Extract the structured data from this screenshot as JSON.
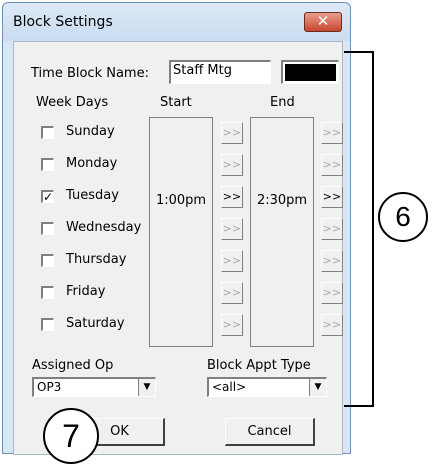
{
  "window": {
    "title": "Block Settings",
    "close_glyph": "✕"
  },
  "form": {
    "time_block_label": "Time Block Name:",
    "time_block_value": "Staff Mtg",
    "color_swatch": "#000000",
    "week_days_label": "Week Days",
    "start_label": "Start",
    "end_label": "End",
    "days": [
      {
        "label": "Sunday",
        "checked": false
      },
      {
        "label": "Monday",
        "checked": false
      },
      {
        "label": "Tuesday",
        "checked": true
      },
      {
        "label": "Wednesday",
        "checked": false
      },
      {
        "label": "Thursday",
        "checked": false
      },
      {
        "label": "Friday",
        "checked": false
      },
      {
        "label": "Saturday",
        "checked": false
      }
    ],
    "start_time": "1:00pm",
    "end_time": "2:30pm",
    "arrow_label": ">>",
    "assigned_op_label": "Assigned Op",
    "assigned_op_value": "OP3",
    "block_appt_type_label": "Block Appt Type",
    "block_appt_type_value": "<all>",
    "ok_label": "OK",
    "cancel_label": "Cancel"
  },
  "callouts": {
    "six": "6",
    "seven": "7"
  },
  "colors": {
    "title_bar": "#c9dcf1",
    "close_button": "#c7452f",
    "dialog_bg": "#f0f0f0"
  }
}
